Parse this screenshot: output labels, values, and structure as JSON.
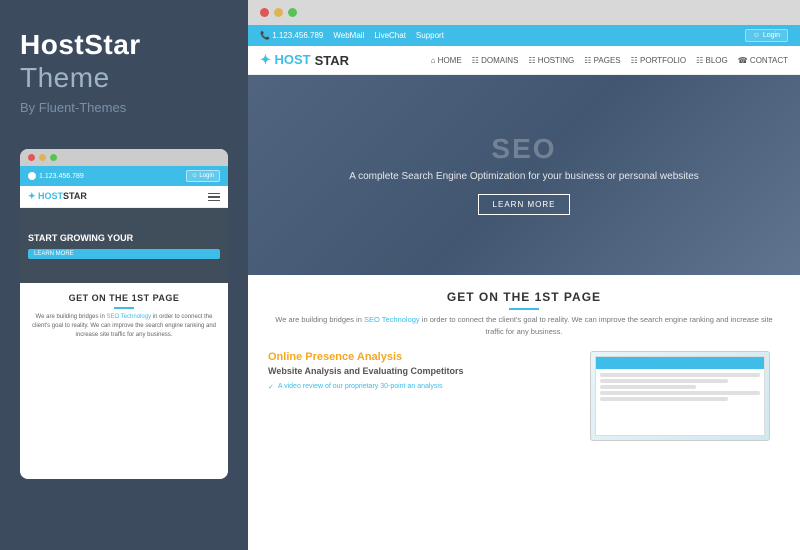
{
  "leftPanel": {
    "title": "HostStar",
    "themeLabel": "Theme",
    "byLine": "By Fluent-Themes",
    "dots": [
      "red",
      "yellow",
      "green"
    ],
    "mobilePreview": {
      "topBar": {
        "phone": "1.123.456.789",
        "loginBtn": "Login"
      },
      "logo": "HOSTSTAR",
      "heroText": "START GROWING YOUR",
      "cta": "LEARN MORE",
      "contentHeading": "GET ON THE 1ST PAGE",
      "contentBody": "We are building bridges in SEO Technology in order to connect the client's goal to reality. We can improve the search engine ranking and increase site traffic for any business."
    }
  },
  "rightPanel": {
    "browserDots": [
      "red",
      "yellow",
      "green"
    ],
    "site": {
      "topBar": {
        "phone": "1.123.456.789",
        "webmail": "WebMail",
        "liveChat": "LiveChat",
        "support": "Support",
        "loginBtn": "Login"
      },
      "nav": {
        "logo": "HOSTSTAR",
        "links": [
          "HOME",
          "DOMAINS",
          "HOSTING",
          "PAGES",
          "PORTFOLIO",
          "BLOG",
          "CONTACT"
        ]
      },
      "hero": {
        "mainText": "SEO",
        "subText": "A complete Search Engine Optimization for your business or personal websites",
        "learnMore": "LEARN MORE"
      },
      "content": {
        "heading": "GET ON THE 1ST PAGE",
        "subtext": "We are building bridges in SEO Technology in order to connect the client's goal to reality. We can improve the search engine ranking and increase site traffic for any business.",
        "seoLink": "SEO Technology",
        "leftCol": {
          "title": "Online",
          "titleHighlight": "Presence Analysis",
          "subtitle": "Website Analysis and Evaluating Competitors",
          "listItems": [
            "A video review of our proprietary 30-point an analysis"
          ]
        }
      }
    }
  }
}
